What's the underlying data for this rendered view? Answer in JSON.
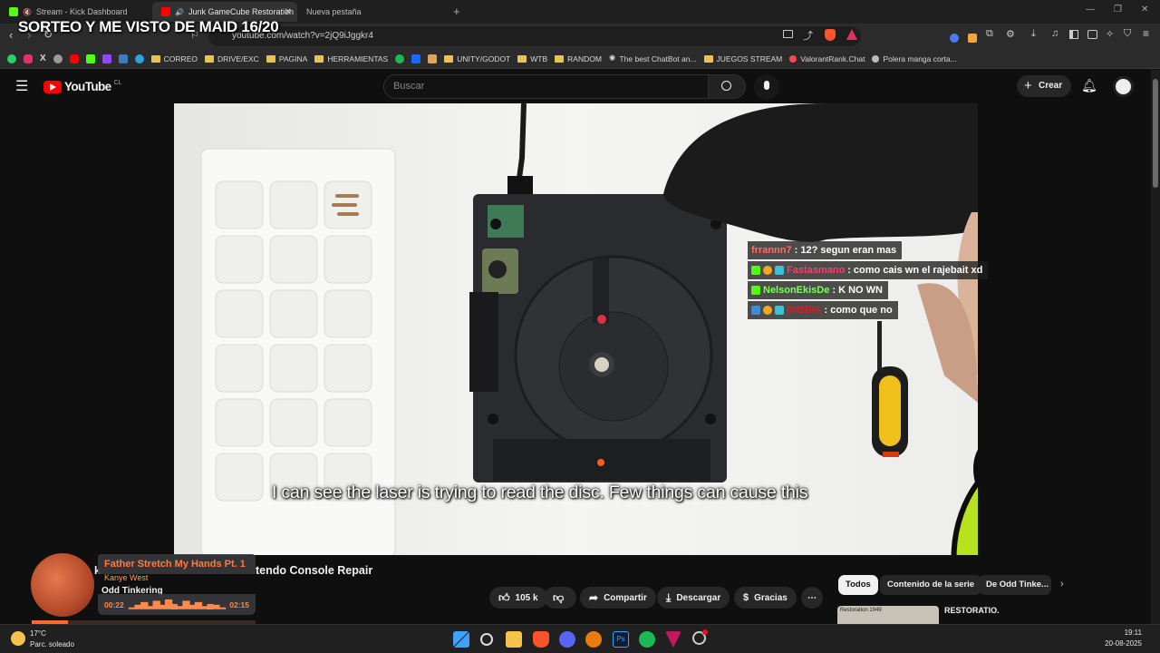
{
  "browser": {
    "tabs": [
      {
        "title": "Stream - Kick Dashboard"
      },
      {
        "title": "Junk GameCube Restoration"
      },
      {
        "title": "Nueva pestaña"
      }
    ],
    "url": "youtube.com/watch?v=2jQ9iJggkr4",
    "bookmarks": [
      "CORREO",
      "DRIVE/EXC",
      "PAGINA",
      "HERRAMIENTAS",
      "UNITY/GODOT",
      "WTB",
      "RANDOM",
      "The best ChatBot an...",
      "JUEGOS STREAM",
      "ValorantRank.Chat",
      "Polera manga corta..."
    ]
  },
  "stream_overlay": {
    "title": "SORTEO Y ME VISTO DE MAID 16/20"
  },
  "youtube": {
    "logo": "YouTube",
    "region": "CL",
    "search_placeholder": "Buscar",
    "create_label": "Crear"
  },
  "video": {
    "subtitle": "I can see the laser is trying to read the disc. Few things can cause this",
    "title_partial": "tendo Console Repair",
    "channel_partial": "Odd Tinkering",
    "likes": "105 k",
    "actions": {
      "share": "Compartir",
      "download": "Descargar",
      "thanks": "Gracias"
    }
  },
  "chat": [
    {
      "user": "frrannn7",
      "message": ": 12? segun eran mas",
      "color": "#ff6b6b"
    },
    {
      "user": "Fastasmano",
      "message": ": como cais wn el rajebait xd",
      "color": "#ff3b6b"
    },
    {
      "user": "NelsonEkisDe",
      "message": ": K NO WN",
      "color": "#7dff5a"
    },
    {
      "user": "DIOBIA",
      "message": ": como que no",
      "color": "#e01a1a"
    }
  ],
  "related_chips": [
    "Todos",
    "Contenido de la serie",
    "De Odd Tinke..."
  ],
  "related_video": {
    "title_partial": "RESTORATIO... TYPEWRIT...",
    "thumb_label": "Restoration 1949"
  },
  "music": {
    "title": "Father Stretch My Hands Pt. 1",
    "artist": "Kanye West",
    "elapsed": "00:22",
    "duration": "02:15",
    "progress": 0.163
  },
  "taskbar": {
    "weather_temp": "17°C",
    "weather_desc": "Parc. soleado",
    "time": "19:11",
    "date": "20-08-2025"
  },
  "colors": {
    "youtube_red": "#ff0000",
    "kick_green": "#53fc18",
    "music_accent": "#ff7a3c",
    "mascot_green": "#b7e31e"
  }
}
